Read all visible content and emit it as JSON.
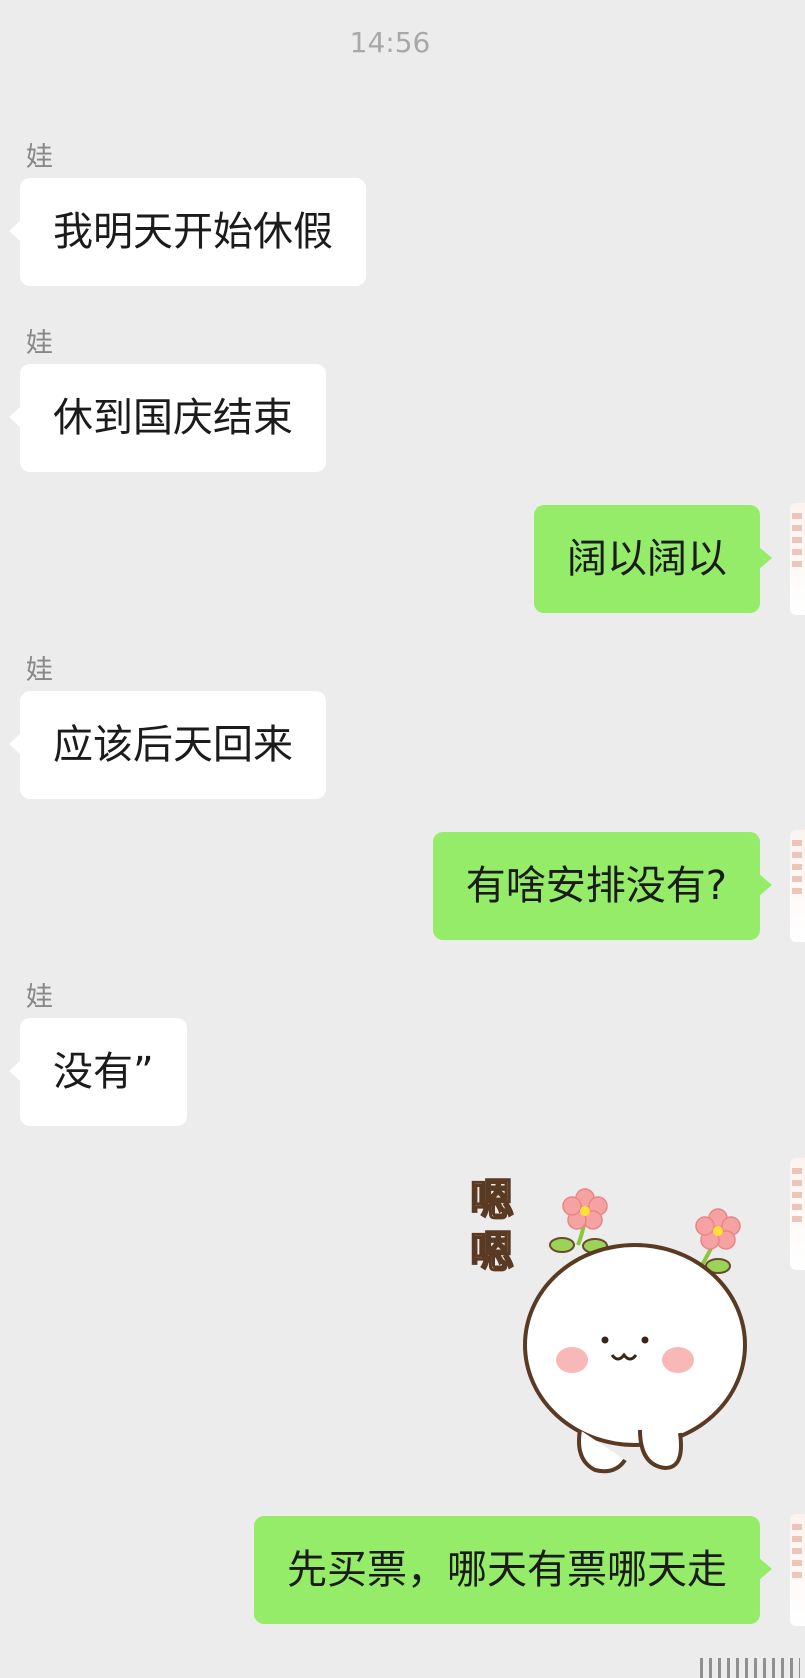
{
  "chat": {
    "timestamp": "14:56",
    "messages": [
      {
        "sender": "娃",
        "text": "我明天开始休假"
      },
      {
        "sender": "娃",
        "text": "休到国庆结束"
      },
      {
        "sender": "",
        "text": "阔以阔以"
      },
      {
        "sender": "娃",
        "text": "应该后天回来"
      },
      {
        "sender": "",
        "text": "有啥安排没有?"
      },
      {
        "sender": "娃",
        "text": "没有”"
      },
      {
        "sender": "",
        "sticker_text": "嗯嗯"
      },
      {
        "sender": "",
        "text": "先买票，哪天有票哪天走"
      }
    ]
  },
  "colors": {
    "background": "#ececec",
    "incoming_bubble": "#ffffff",
    "outgoing_bubble": "#95ec69",
    "sender_name": "#888888",
    "timestamp": "#a8a8a8"
  },
  "icons": {
    "sticker": "smiling-dumpling-with-flowers-sticker",
    "avatar": "user-avatar"
  }
}
